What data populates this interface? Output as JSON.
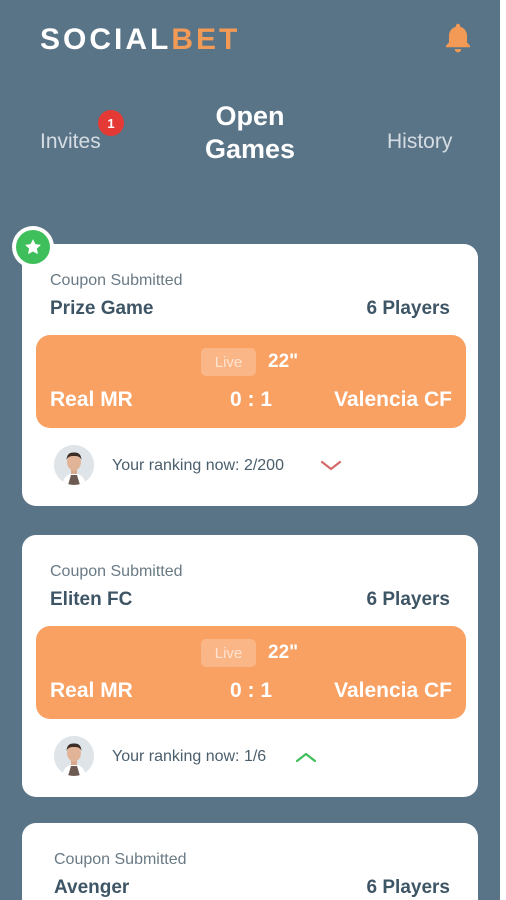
{
  "app": {
    "logo_part1": "SOCIAL",
    "logo_part2": "BET"
  },
  "colors": {
    "background": "#5a7487",
    "accent": "#f39a56",
    "match_bar": "#f9a063",
    "badge": "#e53935",
    "favorite": "#3fbf5b",
    "trend_down": "#d46a6a",
    "trend_up": "#3fbf5b"
  },
  "icons": {
    "notification": "bell-icon",
    "favorite": "star-icon",
    "trend_down": "chevron-down-icon",
    "trend_up": "chevron-up-icon"
  },
  "tabs": {
    "invites": {
      "label": "Invites",
      "badge_count": "1"
    },
    "open_games": {
      "line1": "Open",
      "line2": "Games"
    },
    "history": {
      "label": "History"
    }
  },
  "games": [
    {
      "status": "Coupon Submitted",
      "name": "Prize Game",
      "players": "6 Players",
      "live_label": "Live",
      "minute": "22\"",
      "home_team": "Real MR",
      "score": "0 : 1",
      "away_team": "Valencia CF",
      "ranking": "Your ranking now: 2/200",
      "trend": "down",
      "favorite": true
    },
    {
      "status": "Coupon Submitted",
      "name": "Eliten FC",
      "players": "6 Players",
      "live_label": "Live",
      "minute": "22\"",
      "home_team": "Real MR",
      "score": "0 : 1",
      "away_team": "Valencia CF",
      "ranking": "Your ranking now: 1/6",
      "trend": "up",
      "favorite": false
    },
    {
      "status": "Coupon Submitted",
      "name": "Avenger",
      "players": "6 Players"
    }
  ]
}
